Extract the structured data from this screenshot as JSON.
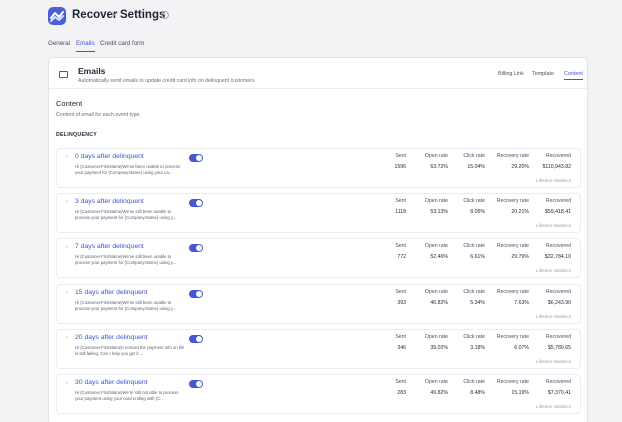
{
  "header": {
    "app": "Recover",
    "separator": ">",
    "page": "Settings"
  },
  "tabs": [
    "General",
    "Emails",
    "Credit card form"
  ],
  "card": {
    "title": "Emails",
    "subtitle": "Automatically send emails to update credit card info on delinquent customers",
    "segments": [
      "Billing Link",
      "Template",
      "Content"
    ]
  },
  "section": {
    "title": "Content",
    "description": "Content of email for each event type.",
    "group": "DELINQUENCY"
  },
  "stat_headers": [
    "Sent",
    "Open rate",
    "Click rate",
    "Recovery rate",
    "Recovered"
  ],
  "lifetime_label": "Lifetime statistics",
  "rows": [
    {
      "name": "0 days after delinquent",
      "preview": "Hi {Customer.FirstName}We've been unable to process your payment for {Company.Name} using your ca...",
      "sent": "1596",
      "open_rate": "63.72%",
      "click_rate": "15.04%",
      "recovery_rate": "29.20%",
      "recovered": "$110,943.82"
    },
    {
      "name": "3 days after delinquent",
      "preview": "Hi {Customer.FirstName}We've still been unable to process your payment for {Company.Name} using y...",
      "sent": "1118",
      "open_rate": "53.13%",
      "click_rate": "8.05%",
      "recovery_rate": "20.21%",
      "recovered": "$59,418.41"
    },
    {
      "name": "7 days after delinquent",
      "preview": "Hi {Customer.FirstName}We've still been unable to process your payment for {Company.Name} using y...",
      "sent": "772",
      "open_rate": "52.46%",
      "click_rate": "6.61%",
      "recovery_rate": "29.79%",
      "recovered": "$32,784.10"
    },
    {
      "name": "15 days after delinquent",
      "preview": "Hi {Customer.FirstName}We've still been unable to process your payment for {Company.Name} using y...",
      "sent": "393",
      "open_rate": "46.82%",
      "click_rate": "5.34%",
      "recovery_rate": "7.63%",
      "recovered": "$6,243.90"
    },
    {
      "name": "20 days after delinquent",
      "preview": "Hi {Customer.FirstName}I noticed the payment info on file is still failing. Can I help you get it ...",
      "sent": "346",
      "open_rate": "39.02%",
      "click_rate": "3.18%",
      "recovery_rate": "6.07%",
      "recovered": "$5,789.65"
    },
    {
      "name": "30 days after delinquent",
      "preview": "Hi {Customer.FirstName}We're still not able to process your payment using your card ending with {C...",
      "sent": "283",
      "open_rate": "49.82%",
      "click_rate": "8.48%",
      "recovery_rate": "15.19%",
      "recovered": "$7,370.41"
    }
  ],
  "colors": {
    "accent": "#3c55d1",
    "toggle": "#4458d6",
    "background": "#f3f3f5"
  }
}
